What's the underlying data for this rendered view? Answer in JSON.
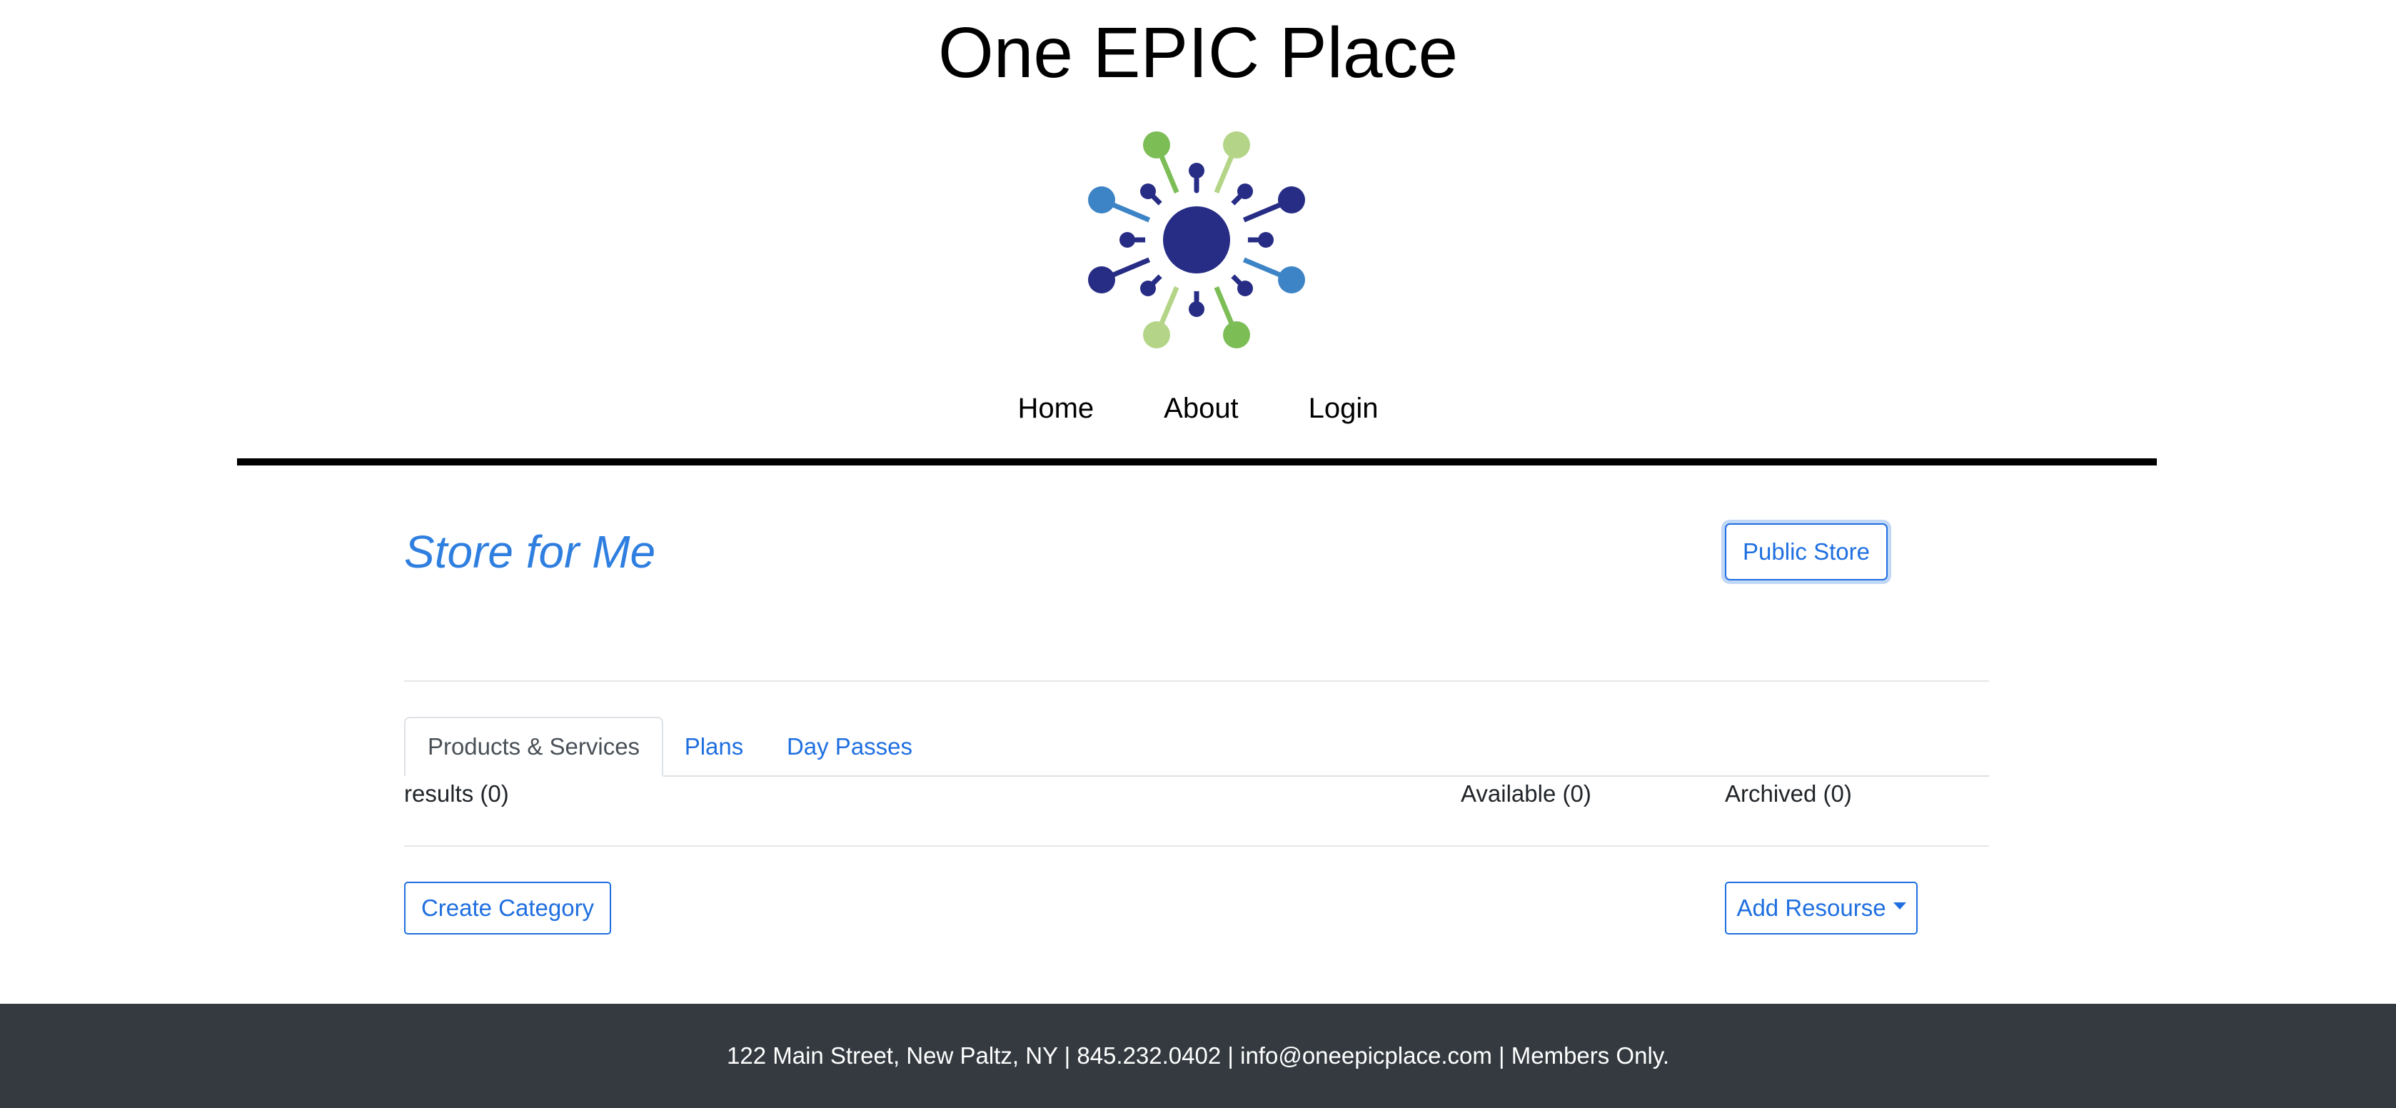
{
  "header": {
    "site_title": "One EPIC Place",
    "logo_icon": "network-hub-logo",
    "nav": [
      {
        "label": "Home"
      },
      {
        "label": "About"
      },
      {
        "label": "Login"
      }
    ]
  },
  "store": {
    "title": "Store for Me",
    "public_store_label": "Public Store"
  },
  "tabs": [
    {
      "label": "Products & Services",
      "active": true
    },
    {
      "label": "Plans",
      "active": false
    },
    {
      "label": "Day Passes",
      "active": false
    }
  ],
  "counts": {
    "results": "results (0)",
    "available": "Available (0)",
    "archived": "Archived (0)"
  },
  "actions": {
    "create_category_label": "Create Category",
    "add_resource_label": "Add Resourse"
  },
  "footer": {
    "text": "122 Main Street, New Paltz, NY | 845.232.0402 | info@oneepicplace.com | Members Only."
  },
  "colors": {
    "link_blue": "#1f6fe0",
    "title_blue": "#2f7fe0",
    "logo_navy": "#272c85",
    "logo_green": "#7cbd56",
    "logo_light_green": "#b4d587",
    "logo_blue": "#3d84c6",
    "footer_bg": "#343a40"
  }
}
